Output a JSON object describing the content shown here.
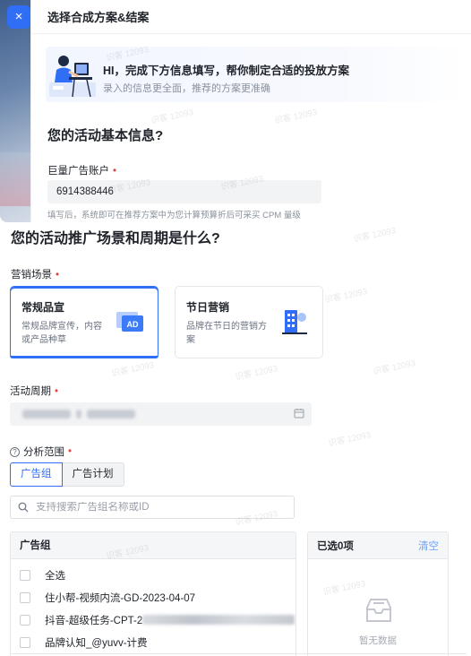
{
  "drawer": {
    "close_icon": "×",
    "title": "选择合成方案&结案"
  },
  "banner": {
    "title": "HI，完成下方信息填写，帮你制定合适的投放方案",
    "subtitle": "录入的信息更全面，推荐的方案更准确"
  },
  "basic_info": {
    "title": "您的活动基本信息?",
    "account_label": "巨量广告账户",
    "account_value": "6914388446",
    "account_hint": "填写后，系统即可在推荐方案中为您计算预算折后可采买 CPM 量级"
  },
  "scene_section": {
    "title": "您的活动推广场景和周期是什么?",
    "scene_label": "营销场景",
    "cards": [
      {
        "title": "常规品宣",
        "desc": "常规品牌宣传，内容或产品种草",
        "icon": "ad-icon",
        "selected": true
      },
      {
        "title": "节日营销",
        "desc": "品牌在节日的营销方案",
        "icon": "building-icon",
        "selected": false
      }
    ],
    "period_label": "活动周期",
    "period_value": "",
    "range_label": "分析范围",
    "range_tabs": [
      "广告组",
      "广告计划"
    ],
    "search_placeholder": "支持搜索广告组名称或ID"
  },
  "ad_list": {
    "header": "广告组",
    "select_all": "全选",
    "items": [
      "住小帮-视频内流-GD-2023-04-07",
      "抖音-超级任务-CPT-2",
      "品牌认知_@yuvv-计费"
    ]
  },
  "selected_panel": {
    "count_label": "已选0项",
    "clear_label": "清空",
    "empty_text": "暂无数据"
  },
  "watermark": "识客 12093",
  "colors": {
    "primary": "#2f6ef5",
    "required": "#e8423d"
  }
}
